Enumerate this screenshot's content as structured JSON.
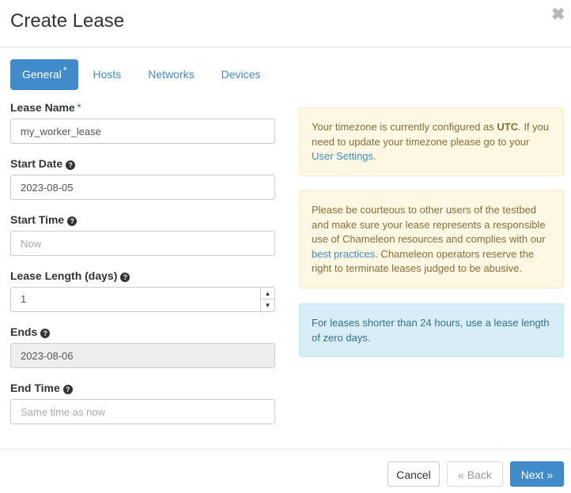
{
  "header": {
    "title": "Create Lease",
    "close_icon": "times-icon",
    "close_glyph": "✖"
  },
  "tabs": [
    {
      "label": "General",
      "required_mark": "*",
      "active": true
    },
    {
      "label": "Hosts",
      "active": false
    },
    {
      "label": "Networks",
      "active": false
    },
    {
      "label": "Devices",
      "active": false
    }
  ],
  "form": {
    "lease_name": {
      "label": "Lease Name",
      "required_mark": "*",
      "value": "my_worker_lease"
    },
    "start_date": {
      "label": "Start Date",
      "help_icon": "question-circle-icon",
      "value": "2023-08-05"
    },
    "start_time": {
      "label": "Start Time",
      "help_icon": "question-circle-icon",
      "value": "",
      "placeholder": "Now"
    },
    "lease_length": {
      "label": "Lease Length (days)",
      "help_icon": "question-circle-icon",
      "value": "1",
      "up_glyph": "▲",
      "down_glyph": "▼"
    },
    "ends": {
      "label": "Ends",
      "help_icon": "question-circle-icon",
      "value": "2023-08-06",
      "disabled": true
    },
    "end_time": {
      "label": "End Time",
      "help_icon": "question-circle-icon",
      "value": "",
      "placeholder": "Same time as now"
    }
  },
  "help_glyph": "?",
  "alerts": {
    "timezone": {
      "text_before": "Your timezone is currently configured as ",
      "timezone": "UTC",
      "text_after": ". If you need to update your timezone please go to your ",
      "link": "User Settings",
      "end": "."
    },
    "courtesy": {
      "text_before": "Please be courteous to other users of the testbed and make sure your lease represents a responsible use of Chameleon resources and complies with our ",
      "link": "best practices",
      "text_after": ". Chameleon operators reserve the right to terminate leases judged to be abusive."
    },
    "info": {
      "text": "For leases shorter than 24 hours, use a lease length of zero days."
    }
  },
  "footer": {
    "cancel": "Cancel",
    "back": "«  Back",
    "next": "Next  »"
  },
  "colors": {
    "primary": "#428bca",
    "warning_bg": "#fcf8e3",
    "info_bg": "#d9edf7"
  }
}
